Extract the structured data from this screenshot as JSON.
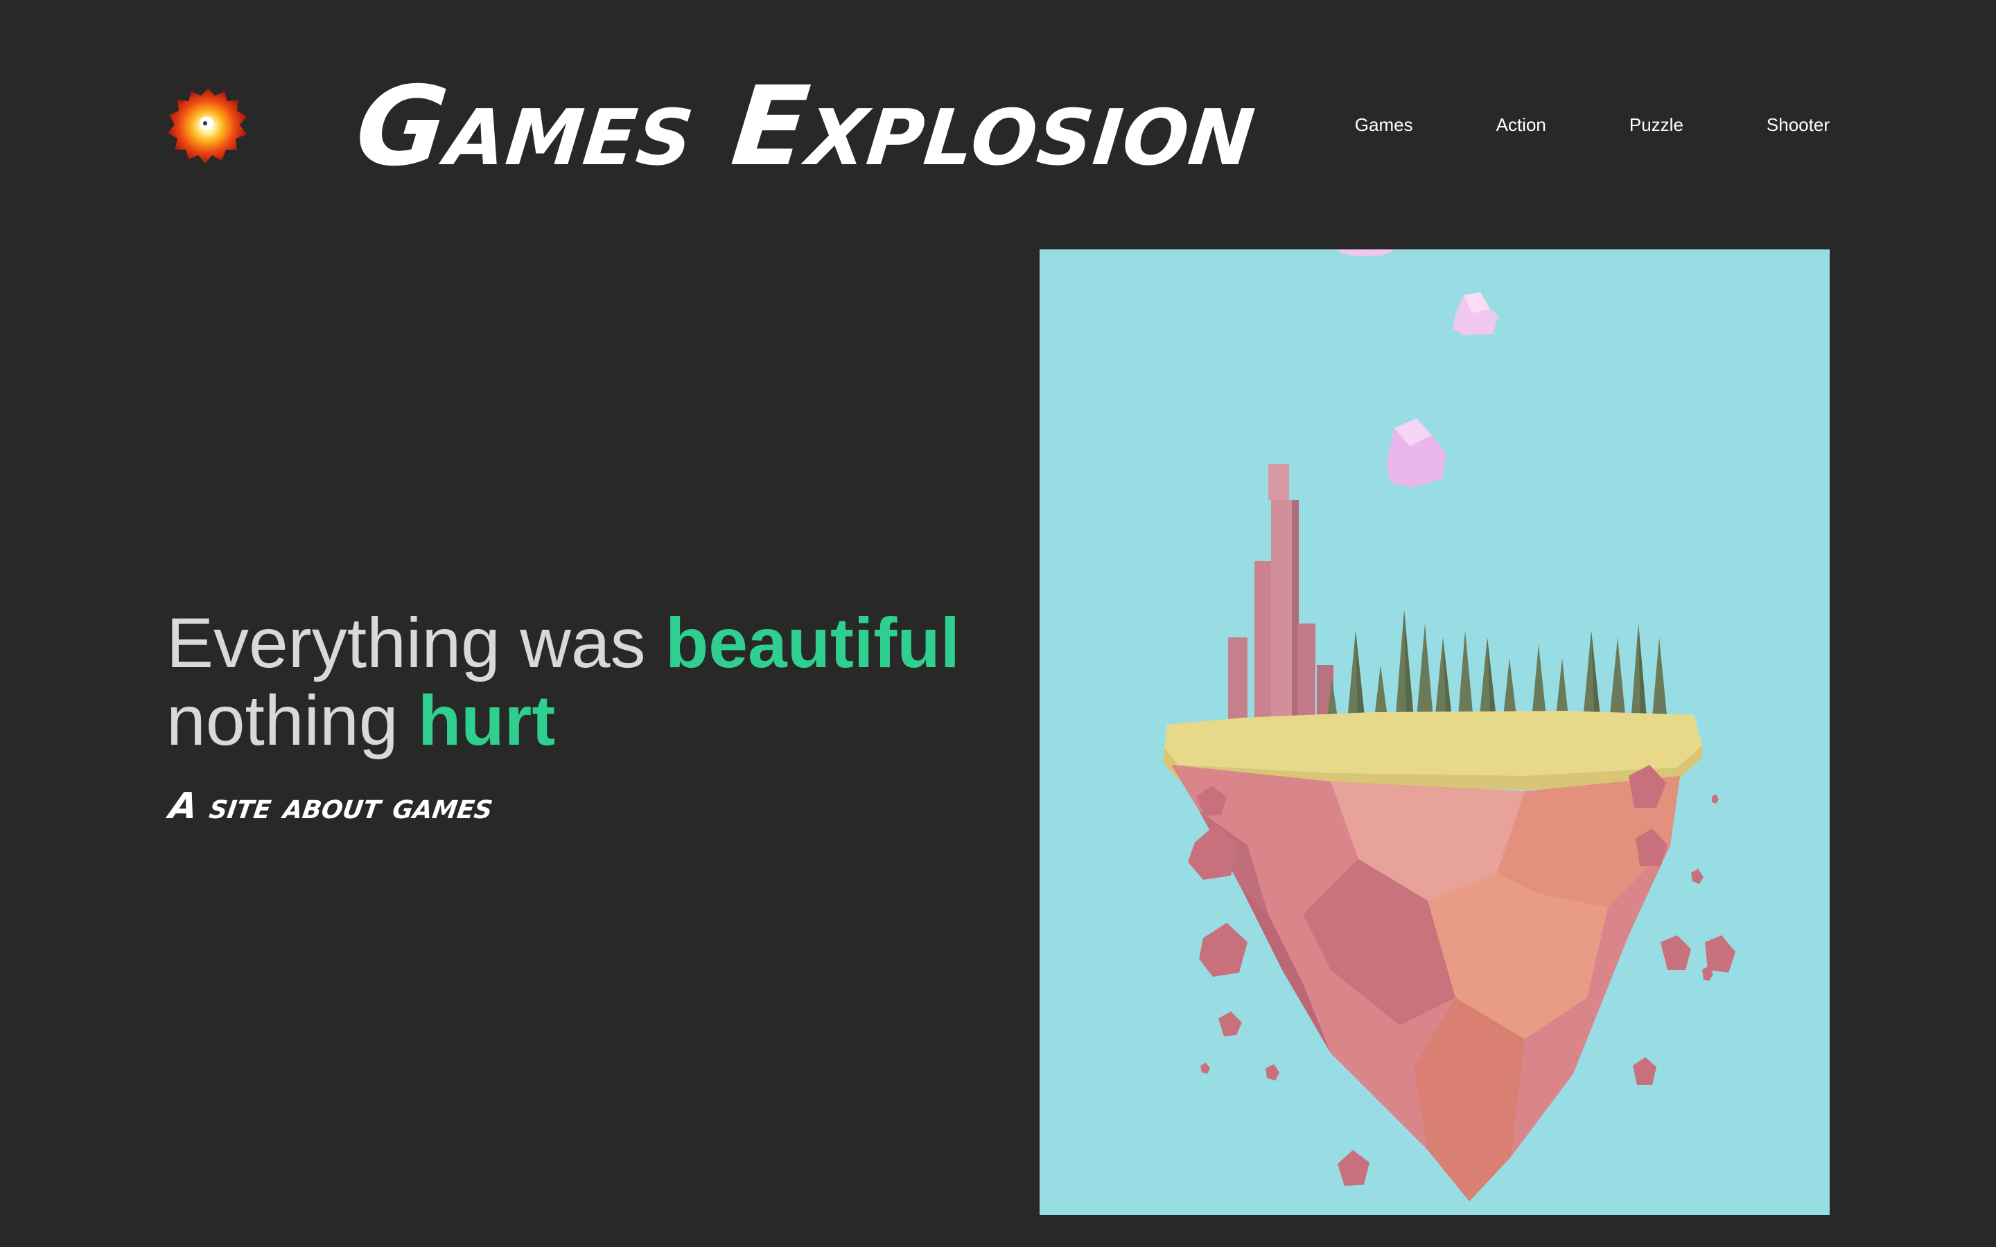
{
  "header": {
    "logo_icon": "explosion-icon",
    "title": "Games Explosion"
  },
  "nav": {
    "items": [
      {
        "label": "Games"
      },
      {
        "label": "Action"
      },
      {
        "label": "Puzzle"
      },
      {
        "label": "Shooter"
      }
    ]
  },
  "hero": {
    "heading": {
      "part1": "Everything was ",
      "accent1": "beautiful",
      "part2": "nothing ",
      "accent2": "hurt"
    },
    "tagline": "A site about games",
    "image_icon": "floating-island-illustration"
  },
  "colors": {
    "background": "#282828",
    "accent": "#2fd08f",
    "heading_text": "#d9d9d9",
    "sky": "#98dde4"
  }
}
